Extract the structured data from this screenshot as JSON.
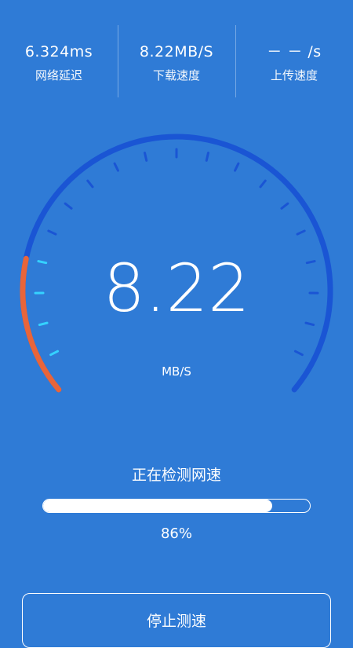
{
  "stats": [
    {
      "value": "6.324ms",
      "label": "网络延迟"
    },
    {
      "value": "8.22MB/S",
      "label": "下载速度"
    },
    {
      "value": "－ － /s",
      "label": "上传速度"
    }
  ],
  "gauge": {
    "speed": "8.22",
    "unit": "MB/S",
    "progress_fraction": 0.2,
    "colors": {
      "track": "#1a55d4",
      "tick": "#1a55d4",
      "active": "#e8653a",
      "active_tick": "#35d2ff"
    }
  },
  "status": "正在检测网速",
  "progress": {
    "percent": 86,
    "label": "86%"
  },
  "buttons": {
    "stop": "停止测速"
  },
  "colors": {
    "background": "#2f7bd6"
  }
}
